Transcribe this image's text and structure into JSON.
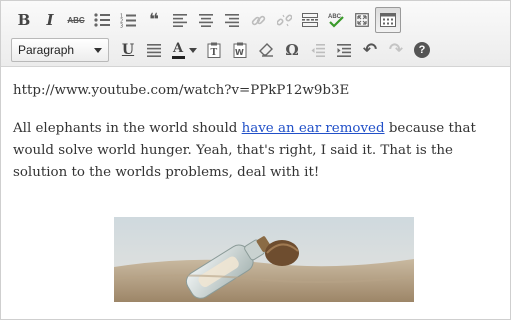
{
  "toolbar": {
    "format_select": {
      "value": "Paragraph"
    },
    "row1_icons": [
      "bold-icon",
      "italic-icon",
      "strikethrough-icon",
      "bulleted-list-icon",
      "numbered-list-icon",
      "blockquote-icon",
      "align-left-icon",
      "align-center-icon",
      "align-right-icon",
      "insert-link-icon",
      "remove-link-icon",
      "more-tag-icon",
      "spellcheck-icon",
      "fullscreen-icon",
      "kitchen-sink-icon"
    ],
    "row2_icons": [
      "underline-icon",
      "justify-icon",
      "text-color-icon",
      "paste-as-text-icon",
      "paste-from-word-icon",
      "clear-formatting-icon",
      "special-character-icon",
      "outdent-icon",
      "indent-icon",
      "undo-icon",
      "redo-icon",
      "help-icon"
    ],
    "glyphs": {
      "bold": "B",
      "italic": "I",
      "strike": "ABC",
      "quote": "❝",
      "underline": "U",
      "text_color": "A",
      "omega": "Ω",
      "undo": "↶",
      "redo": "↷",
      "help": "?",
      "spell": "ABC"
    }
  },
  "content": {
    "url_line": "http://www.youtube.com/watch?v=PPkP12w9b3E",
    "para_before_link": "All elephants in the world should ",
    "link_text": "have an ear removed",
    "para_after_link": " because that would solve world hunger.  Yeah, that's right, I said it.  That is the solution to the worlds problems, deal with it!"
  },
  "colors": {
    "link": "#2150c8",
    "text": "#333333",
    "toolbar_bg": "#ececec",
    "icon": "#5f5f5f",
    "spellcheck_green": "#3a9a2a"
  }
}
